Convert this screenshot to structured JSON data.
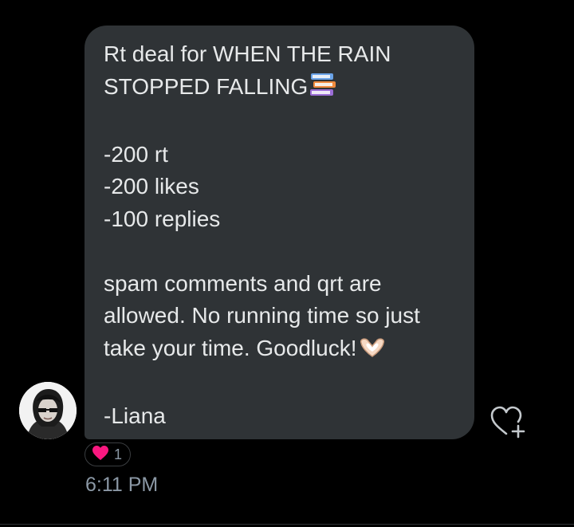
{
  "message": {
    "lines": [
      "Rt deal for WHEN THE RAIN",
      "STOPPED FALLING",
      "",
      "-200 rt",
      "-200 likes",
      "-100 replies",
      "",
      "spam comments and qrt are",
      "allowed. No running time so just",
      "take your time. Goodluck!",
      "",
      "-Liana"
    ],
    "emoji_after_line_2": "books-emoji",
    "emoji_after_line_10": "heart-hands-emoji"
  },
  "reaction": {
    "icon": "red-heart-icon",
    "count": "1"
  },
  "timestamp": "6:11 PM",
  "colors": {
    "background": "#000000",
    "bubble": "#2f3336",
    "text": "#e7e9ea",
    "muted": "#8b98a5",
    "heart": "#f91880"
  }
}
